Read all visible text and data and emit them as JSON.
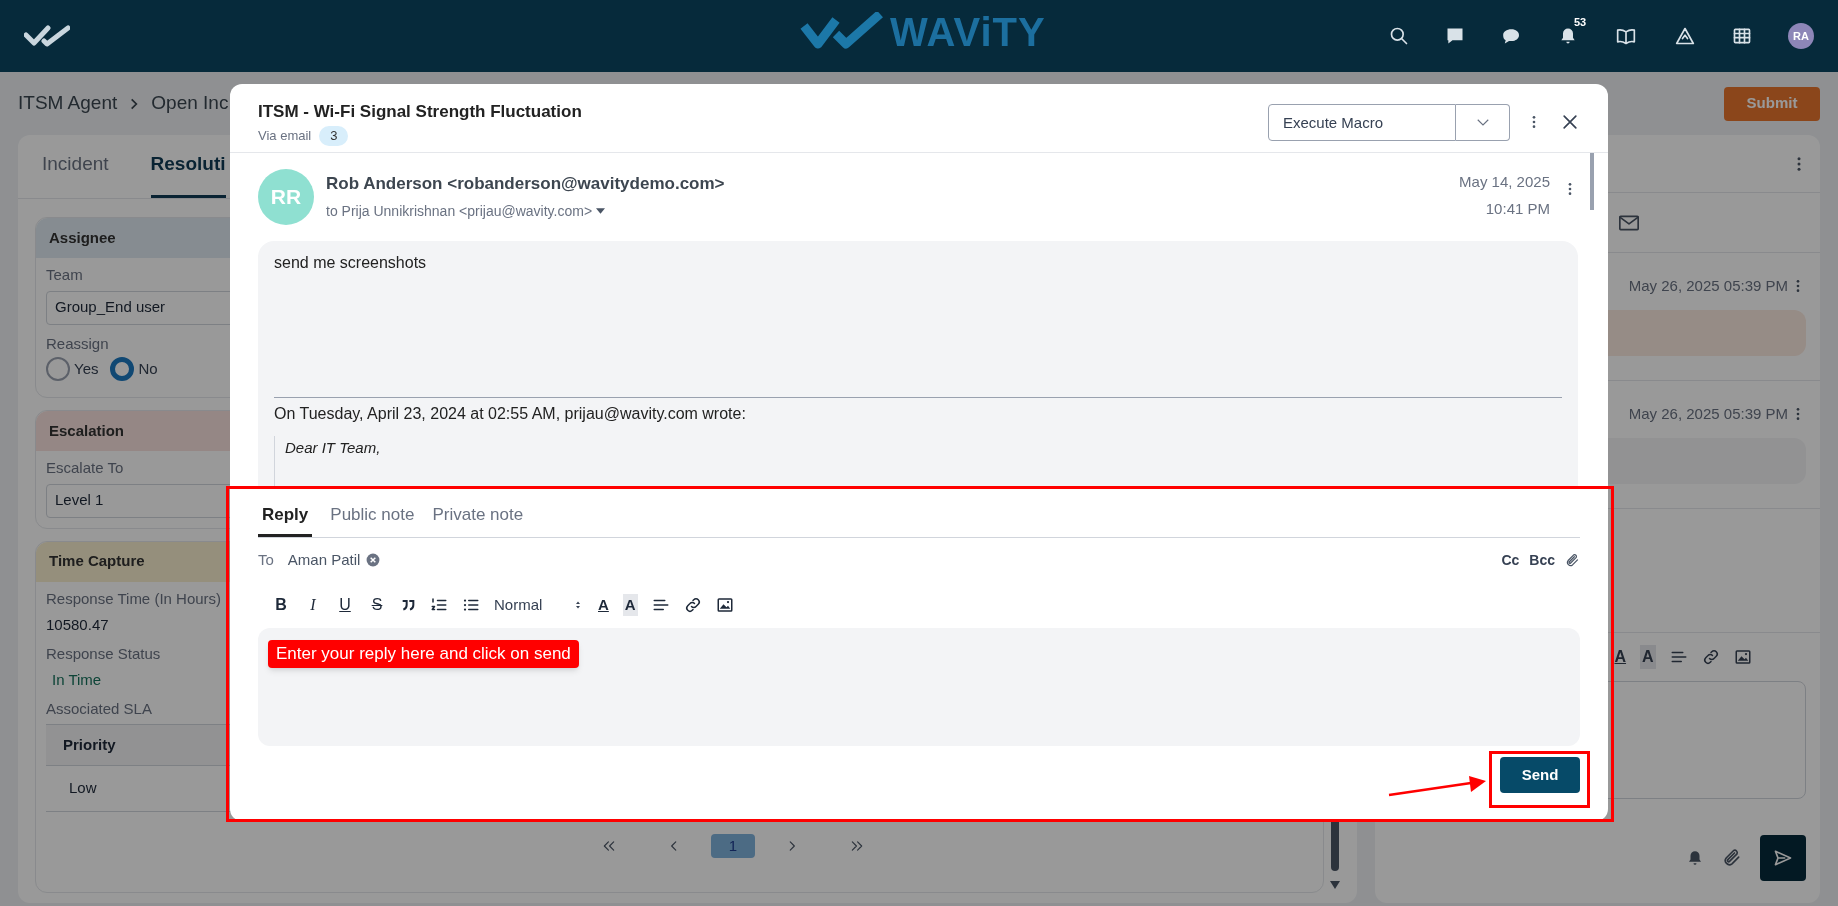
{
  "header": {
    "logo": "WAViTY",
    "notification_count": "53",
    "avatar": "RA"
  },
  "breadcrumb": [
    "ITSM Agent",
    "Open Inc"
  ],
  "submit_button": "Submit",
  "left_panel": {
    "tabs": [
      {
        "label": "Incident",
        "selected": false
      },
      {
        "label": "Resoluti",
        "selected": true
      }
    ],
    "assignee": {
      "title": "Assignee",
      "team_label": "Team",
      "team_value": "Group_End user",
      "reassign_label": "Reassign",
      "options": [
        {
          "label": "Yes",
          "selected": false
        },
        {
          "label": "No",
          "selected": true
        }
      ]
    },
    "escalation": {
      "title": "Escalation",
      "label": "Escalate To",
      "value": "Level 1"
    },
    "time_capture": {
      "title": "Time Capture",
      "fields": [
        {
          "label": "Response Time (In Hours)",
          "value": "10580.47",
          "kind": "text"
        },
        {
          "label": "Response Status",
          "value": "In Time",
          "kind": "status"
        }
      ],
      "sla_label": "Associated SLA",
      "sla_table": {
        "columns": [
          "Priority"
        ],
        "rows": [
          [
            "Low"
          ]
        ]
      }
    },
    "pagination": {
      "pages": [
        {
          "label": "1",
          "selected": true
        }
      ]
    }
  },
  "right_panel": {
    "messages": [
      {
        "time": "May 26, 2025 05:39 PM",
        "kind": "incoming"
      },
      {
        "time": "May 26, 2025 05:39 PM",
        "kind": "note"
      }
    ],
    "format_buttons": [
      {
        "label": "A",
        "kind": "color"
      },
      {
        "label": "A",
        "kind": "highlight"
      }
    ]
  },
  "modal": {
    "title": "ITSM - Wi-Fi Signal Strength Fluctuation",
    "channel": "Via email",
    "count": "3",
    "macro": {
      "placeholder": "Execute Macro"
    },
    "email": {
      "avatar": "RR",
      "from": "Rob Anderson <robanderson@wavitydemo.com>",
      "to": "to Prija Unnikrishnan <prijau@wavity.com>",
      "date": "May 14, 2025",
      "time": "10:41 PM",
      "body": "send me screenshots",
      "quote_header": "On Tuesday, April 23, 2024 at 02:55 AM, prijau@wavity.com wrote:",
      "quote": "Dear IT Team,"
    },
    "reply": {
      "tabs": [
        {
          "label": "Reply",
          "selected": true
        },
        {
          "label": "Public note",
          "selected": false
        },
        {
          "label": "Private note",
          "selected": false
        }
      ],
      "to_label": "To",
      "recipients": [
        "Aman Patil"
      ],
      "cc": "Cc",
      "bcc": "Bcc",
      "format_buttons": [
        {
          "label": "B",
          "kind": "bold"
        },
        {
          "label": "I",
          "kind": "italic"
        },
        {
          "label": "U",
          "kind": "underline"
        },
        {
          "label": "S",
          "kind": "strike"
        }
      ],
      "size": "Normal",
      "color_buttons": [
        {
          "label": "A",
          "kind": "color"
        },
        {
          "label": "A",
          "kind": "highlight"
        }
      ],
      "send": "Send"
    }
  },
  "annotation": {
    "callout": "Enter your reply here and click on send"
  }
}
